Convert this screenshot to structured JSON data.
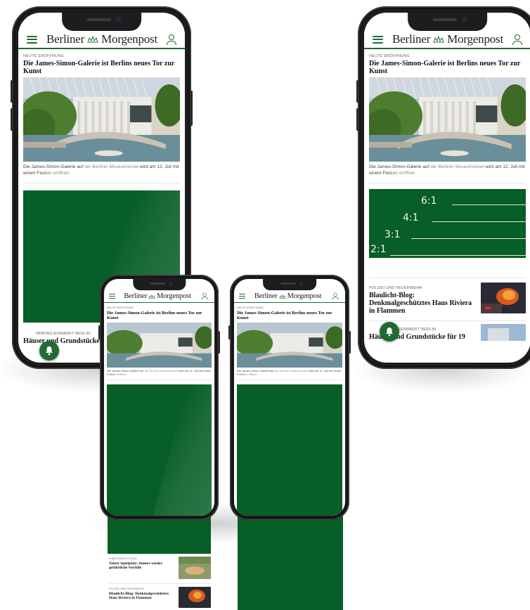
{
  "header": {
    "logo_left": "Berliner",
    "logo_right": "Morgenpost"
  },
  "hero": {
    "kicker": "Heute Eröffnung",
    "headline": "Die James-Simon-Galerie ist Berlins neues Tor zur Kunst",
    "caption_a": "Die James-Simon-Galerie auf ",
    "caption_b": "der Berliner Museumsinsel",
    "caption_c": " wird am 12. Juli mit einem Fest",
    "caption_d": "akt eröffnet."
  },
  "ratios": [
    "6:1",
    "4:1",
    "3:1",
    "2:1"
  ],
  "articles": [
    {
      "kicker": "Immobilienmarkt Berlin",
      "headline": "Häuser und Grundstücke für 19"
    },
    {
      "kicker": "Polizei und Feuerwehr",
      "headline": "Blaulicht-Blog: Denkmalgeschütztes Haus Riviera in Flammen"
    },
    {
      "kicker": "Kinderverletzung",
      "headline": "Tatort Spielplatz: Immer wieder gefährliche Vorfälle"
    }
  ],
  "colors": {
    "brand_green": "#075e27",
    "accent_green": "#1f6b33"
  }
}
